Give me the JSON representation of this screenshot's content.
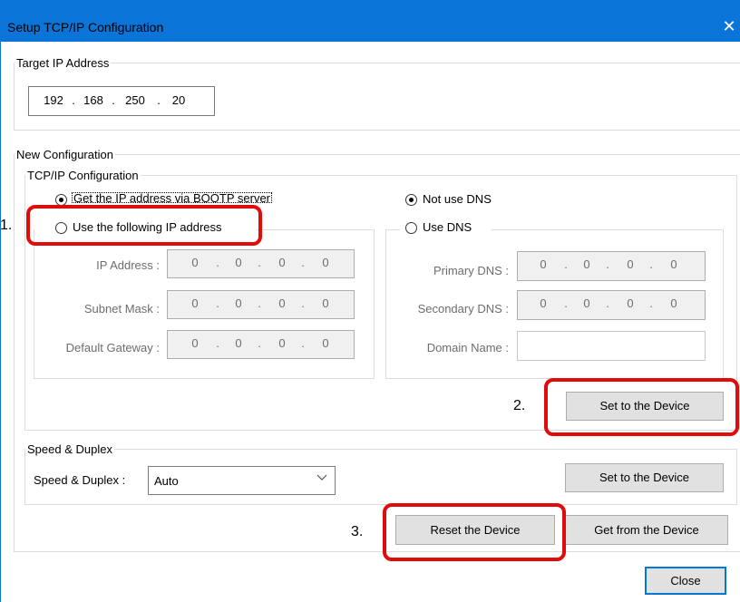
{
  "window": {
    "title": "Setup TCP/IP Configuration",
    "close_glyph": "✕"
  },
  "target": {
    "legend": "Target IP Address",
    "ip": [
      "192",
      "168",
      "250",
      "20"
    ]
  },
  "new_config": {
    "legend": "New Configuration",
    "tcpip": {
      "legend": "TCP/IP Configuration",
      "radio_bootp": "Get the IP address via BOOTP server",
      "radio_following": "Use the following IP address",
      "ip_fields": [
        {
          "label": "IP Address :",
          "value": [
            "0",
            "0",
            "0",
            "0"
          ]
        },
        {
          "label": "Subnet Mask :",
          "value": [
            "0",
            "0",
            "0",
            "0"
          ]
        },
        {
          "label": "Default Gateway :",
          "value": [
            "0",
            "0",
            "0",
            "0"
          ]
        }
      ],
      "radio_not_use_dns": "Not use DNS",
      "radio_use_dns": "Use DNS",
      "dns_fields": [
        {
          "label": "Primary DNS :",
          "value": [
            "0",
            "0",
            "0",
            "0"
          ]
        },
        {
          "label": "Secondary DNS :",
          "value": [
            "0",
            "0",
            "0",
            "0"
          ]
        }
      ],
      "domain_label": "Domain Name :",
      "domain_value": "",
      "set_button": "Set to the Device"
    },
    "speed": {
      "legend": "Speed & Duplex",
      "label": "Speed & Duplex :",
      "selected": "Auto",
      "set_button": "Set to the Device"
    },
    "reset_button": "Reset the Device",
    "get_button": "Get from the Device"
  },
  "close_button": "Close",
  "annotations": [
    "1.",
    "2.",
    "3."
  ],
  "colors": {
    "titlebar": "#0a74d8",
    "highlight": "#e00b0b",
    "default_button_border": "#0078d7"
  }
}
